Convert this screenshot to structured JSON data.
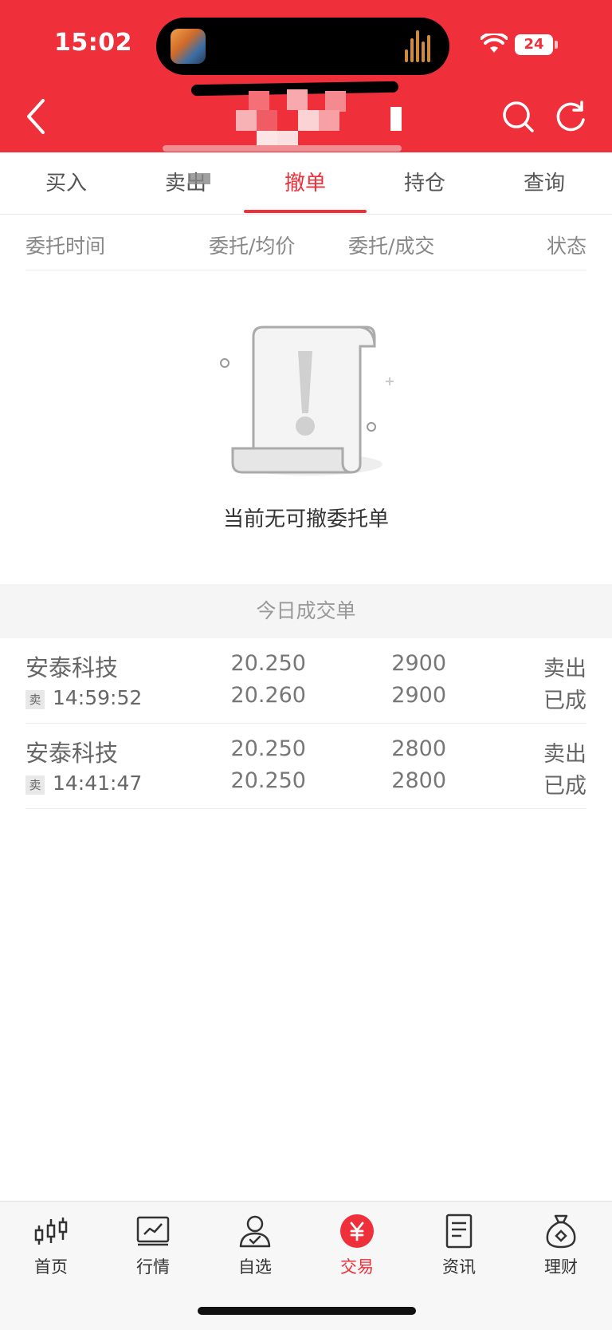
{
  "status_bar": {
    "time": "15:02",
    "battery": "24"
  },
  "tabs": [
    {
      "label": "买入"
    },
    {
      "label": "卖出"
    },
    {
      "label": "撤单"
    },
    {
      "label": "持仓"
    },
    {
      "label": "查询"
    }
  ],
  "active_tab": "撤单",
  "columns": {
    "time": "委托时间",
    "price": "委托/均价",
    "qty": "委托/成交",
    "status": "状态"
  },
  "empty_state": {
    "message": "当前无可撤委托单"
  },
  "section_title": "今日成交单",
  "trades": [
    {
      "name": "安泰科技",
      "side": "卖",
      "time": "14:59:52",
      "order_price": "20.250",
      "avg_price": "20.260",
      "order_qty": "2900",
      "filled_qty": "2900",
      "action": "卖出",
      "status": "已成"
    },
    {
      "name": "安泰科技",
      "side": "卖",
      "time": "14:41:47",
      "order_price": "20.250",
      "avg_price": "20.250",
      "order_qty": "2800",
      "filled_qty": "2800",
      "action": "卖出",
      "status": "已成"
    }
  ],
  "bottom_nav": [
    {
      "label": "首页",
      "icon": "candlestick-icon"
    },
    {
      "label": "行情",
      "icon": "market-chart-icon"
    },
    {
      "label": "自选",
      "icon": "user-check-icon"
    },
    {
      "label": "交易",
      "icon": "yuan-coin-icon",
      "active": true
    },
    {
      "label": "资讯",
      "icon": "news-document-icon"
    },
    {
      "label": "理财",
      "icon": "money-bag-icon"
    }
  ],
  "colors": {
    "brand_red": "#ef2f3a",
    "text_gray": "#777777",
    "section_bg": "#f5f5f5"
  }
}
